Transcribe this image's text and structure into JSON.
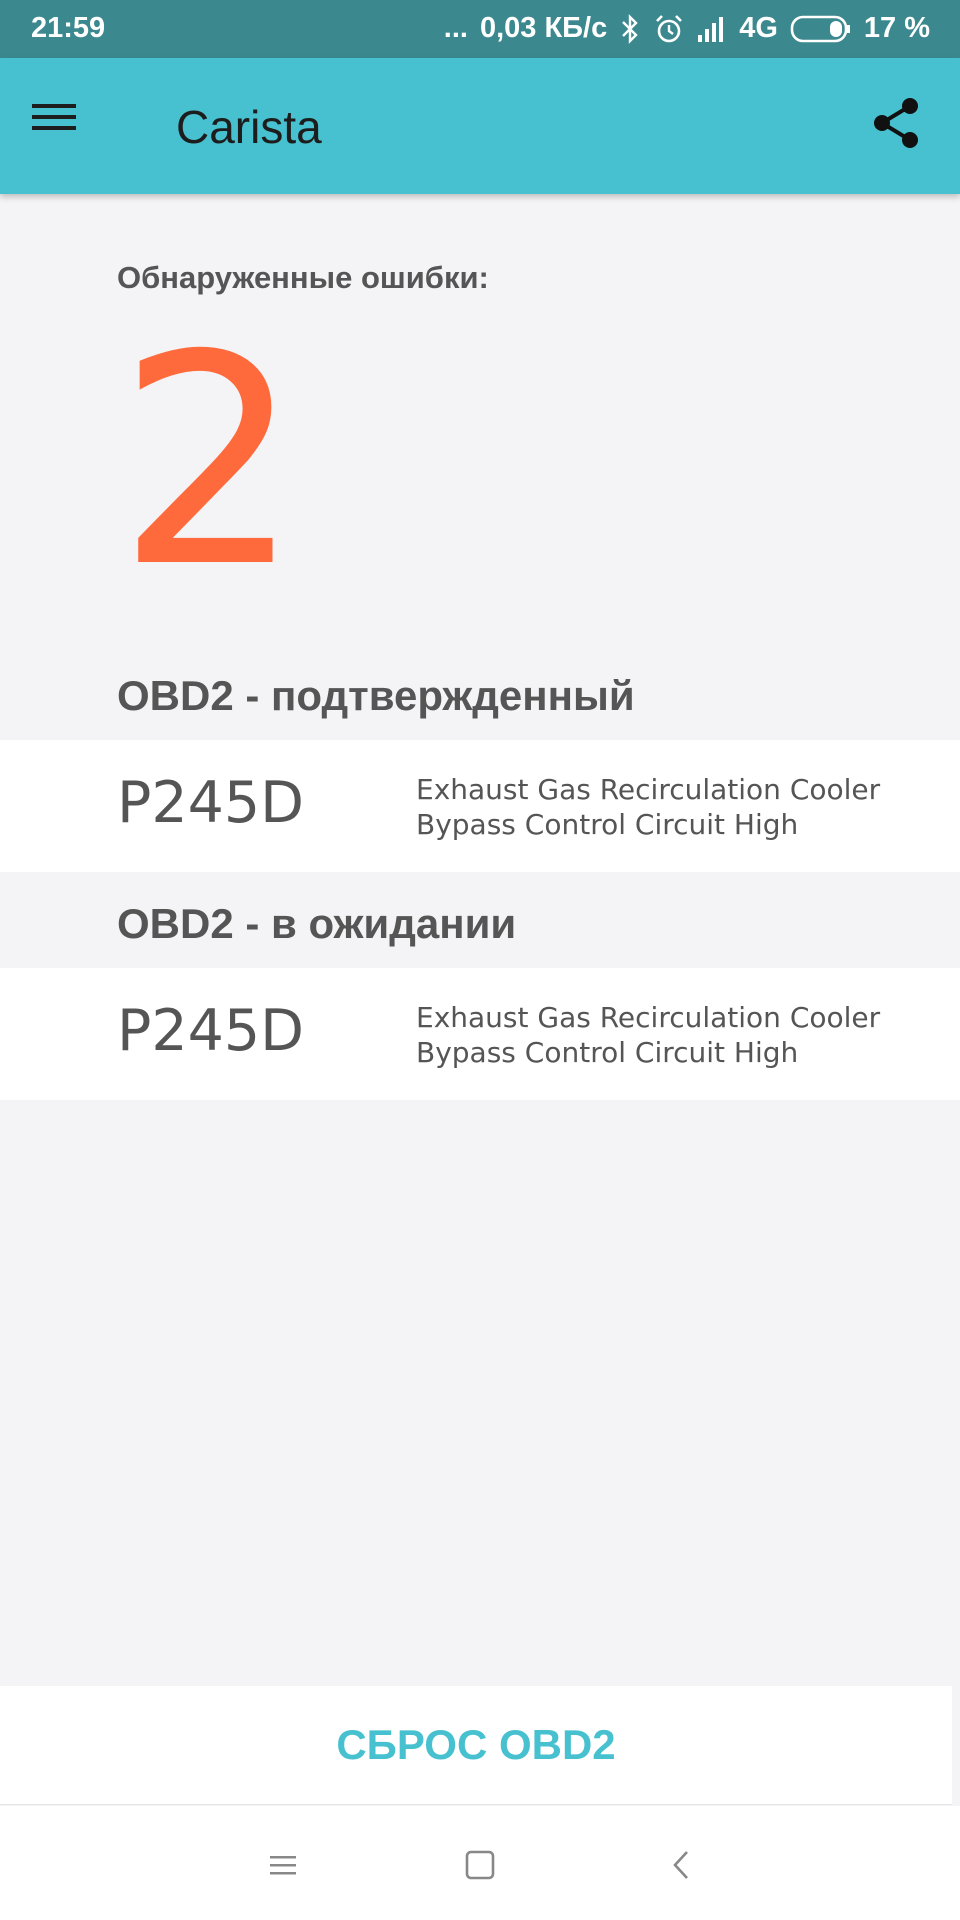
{
  "status_bar": {
    "time": "21:59",
    "dots": "...",
    "network_speed": "0,03 КБ/с",
    "network_type": "4G",
    "battery_percent": "17 %",
    "icons": [
      "bluetooth-icon",
      "alarm-icon",
      "signal-icon",
      "battery-icon"
    ]
  },
  "app_bar": {
    "title": "Carista",
    "menu_icon": "hamburger-menu-icon",
    "share_icon": "share-icon",
    "background_color": "#47c1cf"
  },
  "summary": {
    "label": "Обнаруженные ошибки:",
    "count": "2",
    "count_color": "#ff6a3c"
  },
  "sections": [
    {
      "header": "OBD2 - подтвержденный",
      "items": [
        {
          "code": "P245D",
          "description_line1": "Exhaust Gas Recirculation Cooler",
          "description_line2": "Bypass Control Circuit High"
        }
      ]
    },
    {
      "header": "OBD2 - в ожидании",
      "items": [
        {
          "code": "P245D",
          "description_line1": "Exhaust Gas Recirculation Cooler",
          "description_line2": "Bypass Control Circuit High"
        }
      ]
    }
  ],
  "reset_button": {
    "label": "СБРОС OBD2",
    "color": "#47c1cf"
  },
  "nav_bar": {
    "icons": [
      "recents-icon",
      "home-icon",
      "back-icon"
    ]
  }
}
